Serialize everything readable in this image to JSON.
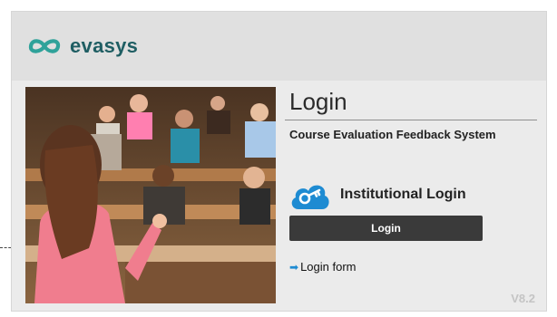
{
  "app": {
    "name": "evasys",
    "version": "V8.2",
    "brand_color": "#1f5e63",
    "accent_color": "#1e8bd2"
  },
  "login": {
    "title": "Login",
    "subtitle": "Course Evaluation Feedback System",
    "institutional_label": "Institutional Login",
    "institutional_icon": "cloud-key-icon",
    "button_label": "Login",
    "form_link_label": "Login form",
    "form_link_icon": "arrow-right-icon"
  },
  "photo": {
    "description_icon": "lecture-hall-photo"
  }
}
